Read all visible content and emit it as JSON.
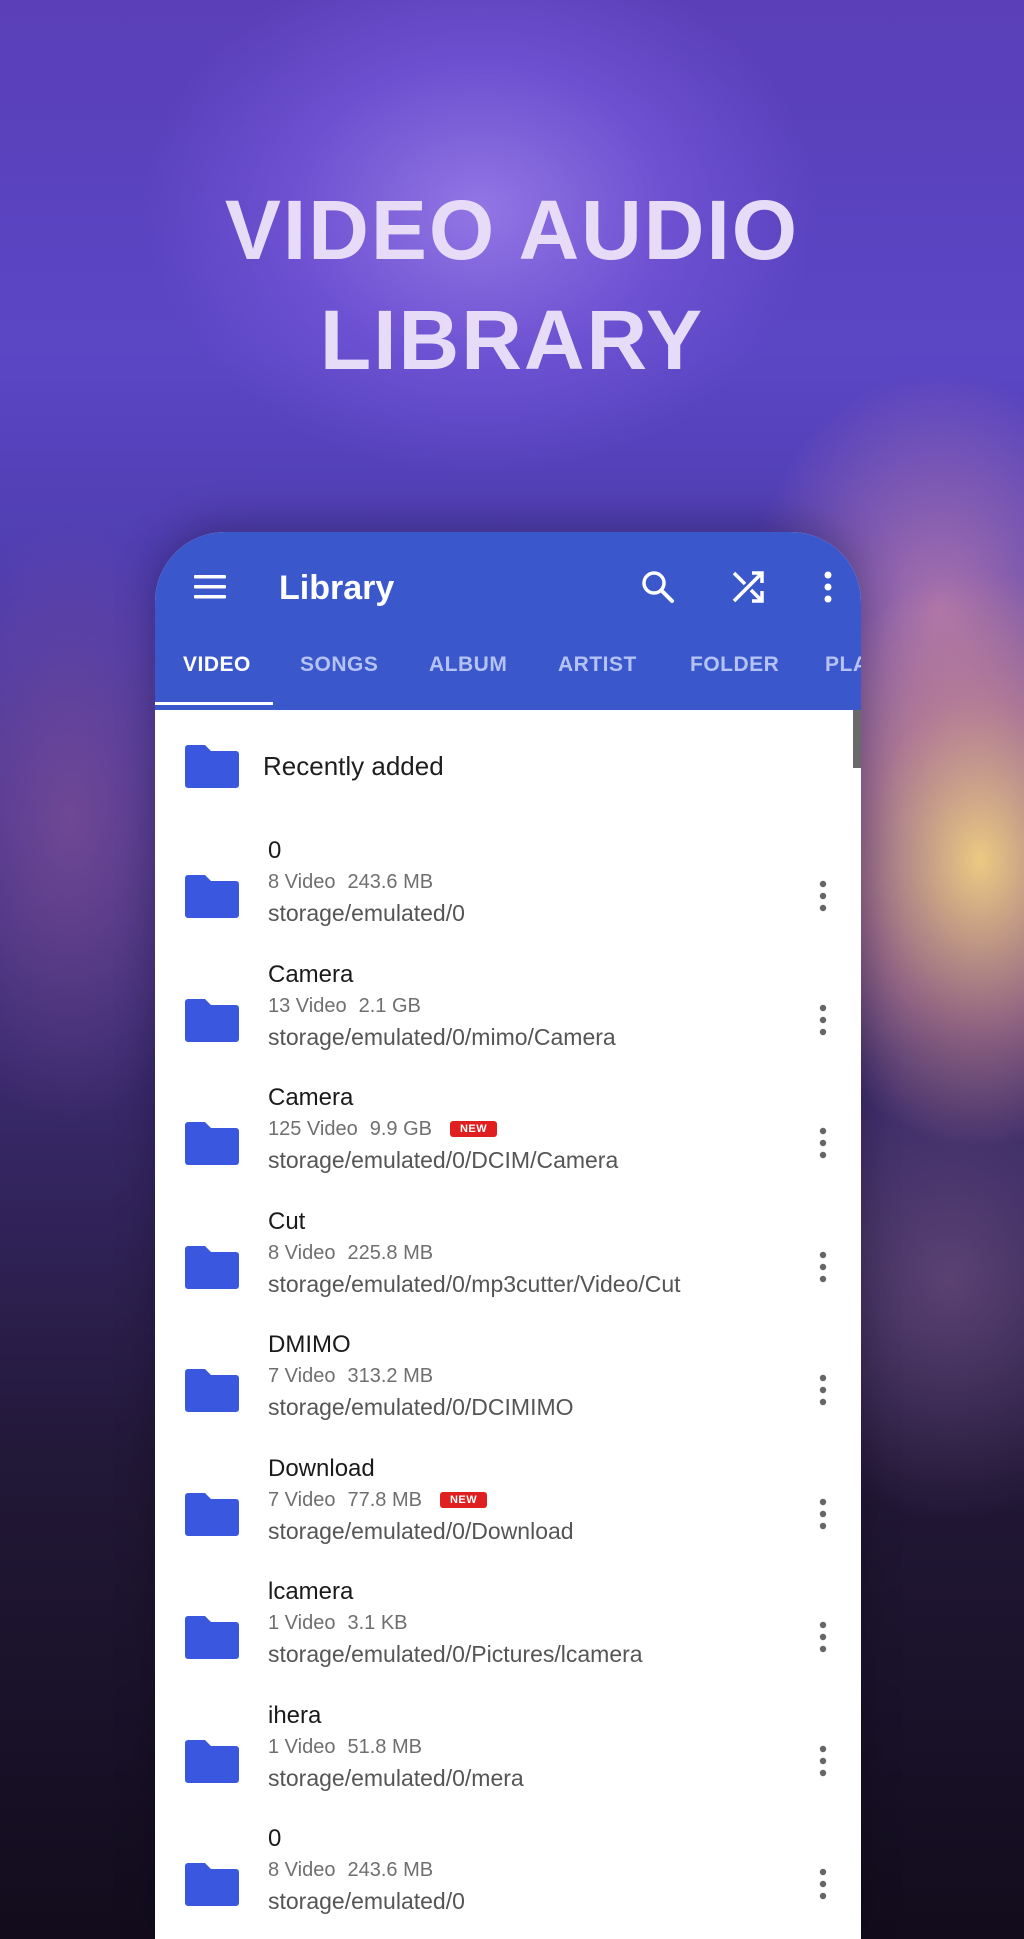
{
  "headline": {
    "line1": "VIDEO AUDIO",
    "line2": "LIBRARY"
  },
  "appbar": {
    "title": "Library",
    "menu_icon": "menu-icon",
    "search_icon": "search-icon",
    "shuffle_icon": "shuffle-icon",
    "more_icon": "more-vert-icon",
    "color": "#3a57cc"
  },
  "tabs": [
    {
      "label": "VIDEO",
      "active": true
    },
    {
      "label": "SONGS",
      "active": false
    },
    {
      "label": "ALBUM",
      "active": false
    },
    {
      "label": "ARTIST",
      "active": false
    },
    {
      "label": "FOLDER",
      "active": false
    },
    {
      "label": "PLA",
      "active": false
    }
  ],
  "recent": {
    "label": "Recently added",
    "icon": "folder-icon"
  },
  "folders": [
    {
      "name": "0",
      "count": "8 Video",
      "size": "243.6 MB",
      "path": "storage/emulated/0",
      "badge": ""
    },
    {
      "name": "Camera",
      "count": "13 Video",
      "size": "2.1 GB",
      "path": "storage/emulated/0/mimo/Camera",
      "badge": ""
    },
    {
      "name": "Camera",
      "count": "125 Video",
      "size": "9.9 GB",
      "path": "storage/emulated/0/DCIM/Camera",
      "badge": "NEW"
    },
    {
      "name": "Cut",
      "count": "8 Video",
      "size": "225.8 MB",
      "path": "storage/emulated/0/mp3cutter/Video/Cut",
      "badge": ""
    },
    {
      "name": "DMIMO",
      "count": "7 Video",
      "size": "313.2 MB",
      "path": "storage/emulated/0/DCIMIMO",
      "badge": ""
    },
    {
      "name": "Download",
      "count": "7 Video",
      "size": "77.8 MB",
      "path": "storage/emulated/0/Download",
      "badge": "NEW"
    },
    {
      "name": "lcamera",
      "count": "1 Video",
      "size": "3.1 KB",
      "path": "storage/emulated/0/Pictures/lcamera",
      "badge": ""
    },
    {
      "name": "ihera",
      "count": "1 Video",
      "size": "51.8 MB",
      "path": "storage/emulated/0/mera",
      "badge": ""
    },
    {
      "name": "0",
      "count": "8 Video",
      "size": "243.6 MB",
      "path": "storage/emulated/0",
      "badge": ""
    }
  ],
  "colors": {
    "folder": "#3a57e0",
    "badge": "#e02020"
  }
}
